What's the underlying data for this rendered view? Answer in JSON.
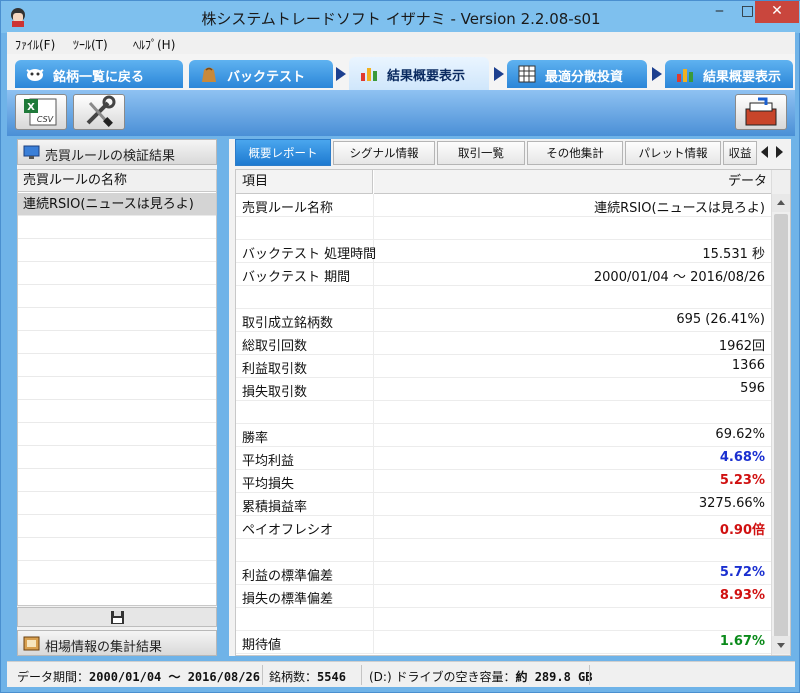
{
  "window": {
    "title": "株システムトレードソフト イザナミ - Version 2.2.08-s01",
    "minimize_glyph": "‒",
    "maximize_glyph": "□",
    "close_glyph": "✕"
  },
  "menu": [
    {
      "label": "ﾌｧｲﾙ(F)"
    },
    {
      "label": "ﾂｰﾙ(T)"
    },
    {
      "label": "ﾍﾙﾌﾟ(H)"
    }
  ],
  "nav_tabs": [
    {
      "label": "銘柄一覧に戻る",
      "icon": "cow-icon"
    },
    {
      "label": "バックテスト",
      "icon": "bag-icon"
    },
    {
      "label": "結果概要表示",
      "icon": "bar-chart-icon",
      "active": true
    },
    {
      "label": "最適分散投資",
      "icon": "grid-icon"
    },
    {
      "label": "結果概要表示",
      "icon": "bar-chart-icon"
    }
  ],
  "toolbar": {
    "csv_label": "CSV",
    "csv_letter": "X"
  },
  "left": {
    "rules_header": "売買ルールの検証結果",
    "rules_column": "売買ルールの名称",
    "rules": [
      "連続RSIO(ニュースは見ろよ)"
    ],
    "market_header": "相場情報の集計結果"
  },
  "subtabs": [
    "概要レポート",
    "シグナル情報",
    "取引一覧",
    "その他集計",
    "パレット情報",
    "収益"
  ],
  "report": {
    "col_item": "項目",
    "col_data": "データ",
    "rows": [
      {
        "k": "売買ルール名称",
        "v": "連続RSIO(ニュースは見ろよ)"
      },
      {
        "k": "",
        "v": ""
      },
      {
        "k": "バックテスト 処理時間",
        "v": "15.531 秒"
      },
      {
        "k": "バックテスト 期間",
        "v": "2000/01/04 ～ 2016/08/26"
      },
      {
        "k": "",
        "v": ""
      },
      {
        "k": "取引成立銘柄数",
        "v": "695 (26.41%)"
      },
      {
        "k": "総取引回数",
        "v": "1962回"
      },
      {
        "k": "利益取引数",
        "v": "1366"
      },
      {
        "k": "損失取引数",
        "v": "596"
      },
      {
        "k": "",
        "v": ""
      },
      {
        "k": "勝率",
        "v": "69.62%"
      },
      {
        "k": "平均利益",
        "v": "4.68%",
        "style": "blue"
      },
      {
        "k": "平均損失",
        "v": "5.23%",
        "style": "red"
      },
      {
        "k": "累積損益率",
        "v": "3275.66%"
      },
      {
        "k": "ペイオフレシオ",
        "v": "0.90倍",
        "style": "red"
      },
      {
        "k": "",
        "v": ""
      },
      {
        "k": "利益の標準偏差",
        "v": "5.72%",
        "style": "blue"
      },
      {
        "k": "損失の標準偏差",
        "v": "8.93%",
        "style": "red"
      },
      {
        "k": "",
        "v": ""
      },
      {
        "k": "期待値",
        "v": "1.67%",
        "style": "green"
      }
    ]
  },
  "status": {
    "period_label": "データ期間：",
    "period_value": "2000/01/04 ～ 2016/08/26",
    "count_label": "銘柄数：",
    "count_value": "5546",
    "drive_label": "(D:) ドライブの空き容量：",
    "drive_value": "約 289.8 GB"
  }
}
